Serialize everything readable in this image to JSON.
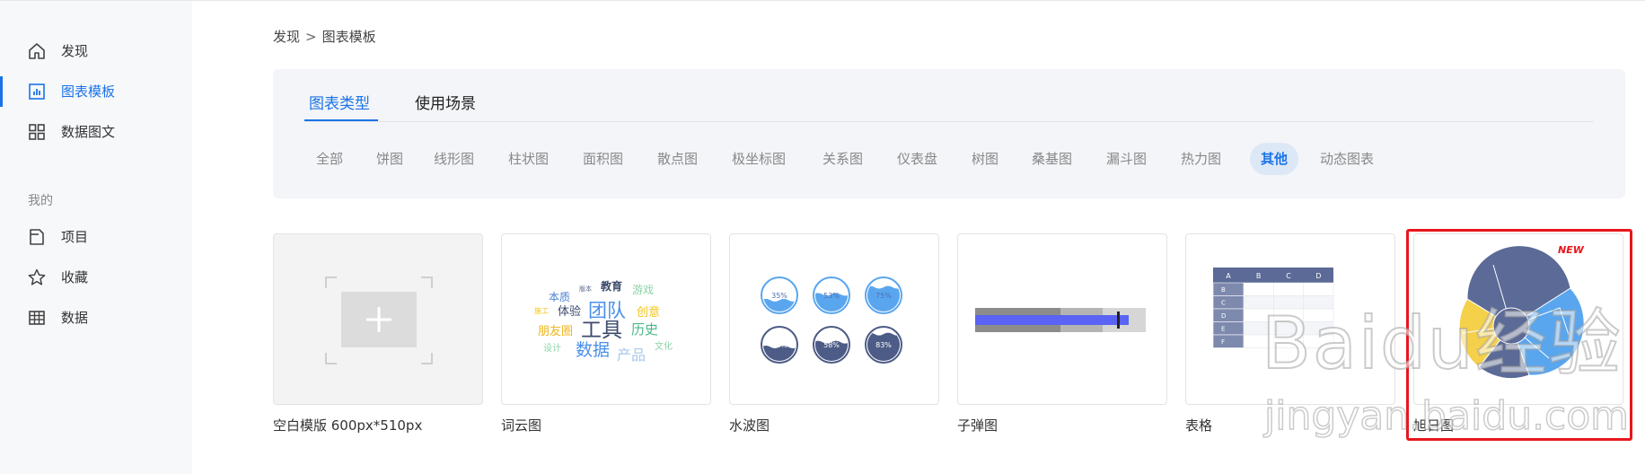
{
  "sidebar": {
    "items": [
      {
        "label": "发现",
        "icon": "home-icon"
      },
      {
        "label": "图表模板",
        "icon": "chart-icon",
        "active": true
      },
      {
        "label": "数据图文",
        "icon": "grid-icon"
      }
    ],
    "section_label": "我的",
    "my_items": [
      {
        "label": "项目",
        "icon": "folder-icon"
      },
      {
        "label": "收藏",
        "icon": "star-icon"
      },
      {
        "label": "数据",
        "icon": "table-icon"
      }
    ]
  },
  "breadcrumb": {
    "root": "发现",
    "separator": ">",
    "current": "图表模板"
  },
  "tabs": [
    {
      "label": "图表类型",
      "active": true
    },
    {
      "label": "使用场景"
    }
  ],
  "filters": [
    {
      "label": "全部"
    },
    {
      "label": "饼图"
    },
    {
      "label": "线形图"
    },
    {
      "label": "柱状图"
    },
    {
      "label": "面积图"
    },
    {
      "label": "散点图"
    },
    {
      "label": "极坐标图"
    },
    {
      "label": "关系图"
    },
    {
      "label": "仪表盘"
    },
    {
      "label": "树图"
    },
    {
      "label": "桑基图"
    },
    {
      "label": "漏斗图"
    },
    {
      "label": "热力图"
    },
    {
      "label": "其他",
      "active": true
    },
    {
      "label": "动态图表"
    }
  ],
  "cards": [
    {
      "title": "空白模版 600px*510px",
      "thumb": "blank"
    },
    {
      "title": "词云图",
      "thumb": "wordcloud",
      "words": [
        "本质",
        "版本",
        "教育",
        "游戏",
        "施工",
        "体验",
        "团队",
        "创意",
        "工具",
        "朋友圈",
        "历史",
        "设计",
        "数据",
        "产品",
        "文化"
      ]
    },
    {
      "title": "水波图",
      "thumb": "liquid",
      "percents": [
        "35%",
        "53%",
        "75%",
        "43%",
        "58%",
        "83%"
      ]
    },
    {
      "title": "子弹图",
      "thumb": "bullet"
    },
    {
      "title": "表格",
      "thumb": "table",
      "columns": [
        "A",
        "B",
        "C",
        "D"
      ],
      "rows": [
        "B",
        "C",
        "D",
        "E",
        "F"
      ]
    },
    {
      "title": "旭日图",
      "thumb": "sunburst",
      "badge": "NEW"
    }
  ],
  "watermark": {
    "logo": "Baidu经验",
    "url": "jingyan.baidu.com"
  },
  "colors": {
    "accent": "#1a73e8",
    "highlight": "#e8161b",
    "badge": "#e8161b"
  }
}
